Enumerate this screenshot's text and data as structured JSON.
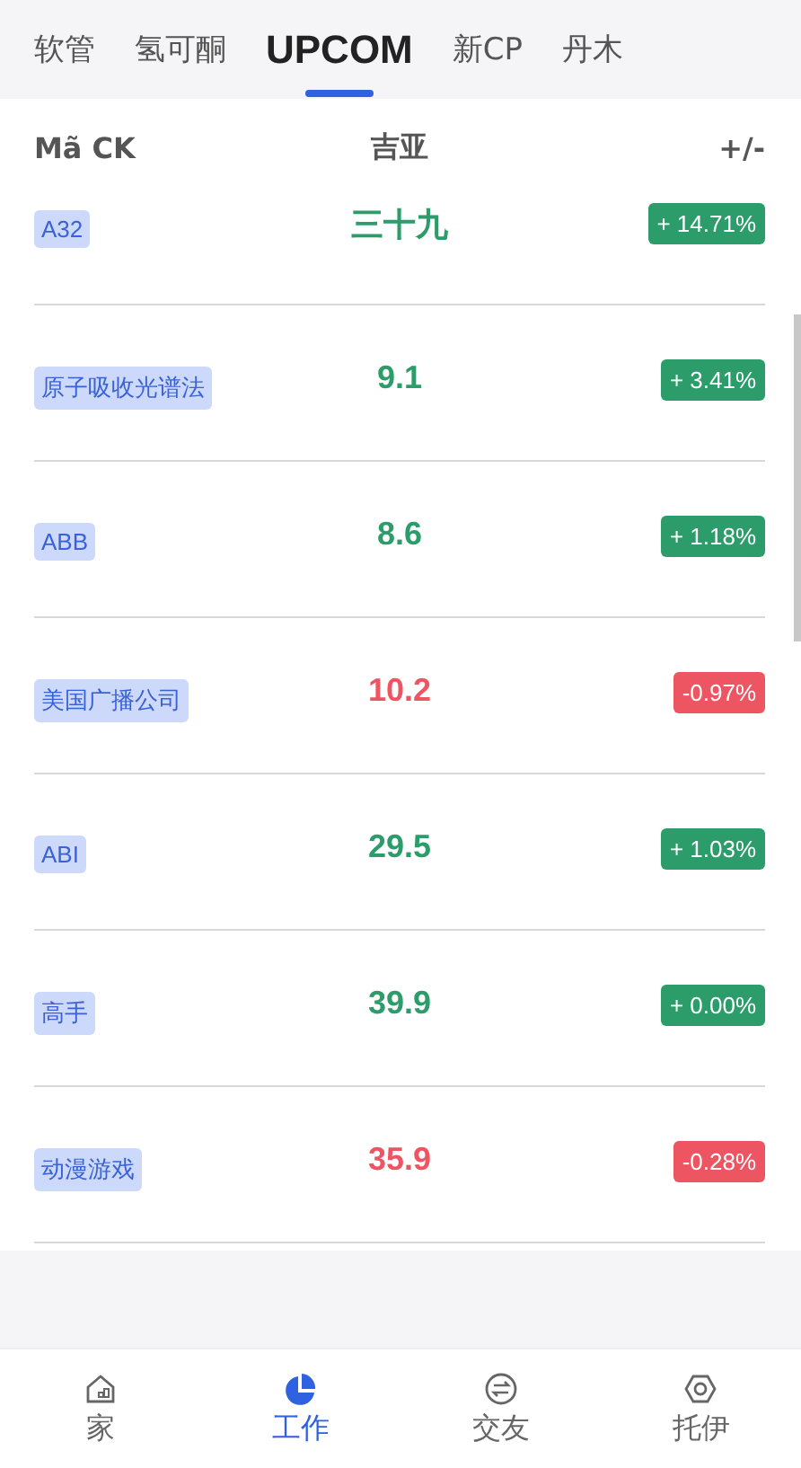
{
  "tabs": [
    {
      "label": "软管",
      "selected": false
    },
    {
      "label": "氢可酮",
      "selected": false
    },
    {
      "label": "UPCOM",
      "selected": true
    },
    {
      "label": "新CP",
      "selected": false
    },
    {
      "label": "丹木",
      "selected": false
    }
  ],
  "table": {
    "columns": [
      "Mã CK",
      "吉亚",
      "+/-"
    ],
    "rows": [
      {
        "code": "A32",
        "price": "三十九",
        "change": "+ 14.71%",
        "color": "#2c9c6a"
      },
      {
        "code": "原子吸收光谱法",
        "price": "9.1",
        "change": "+ 3.41%",
        "color": "#2c9c6a"
      },
      {
        "code": "ABB",
        "price": "8.6",
        "change": "+ 1.18%",
        "color": "#2c9c6a"
      },
      {
        "code": "美国广播公司",
        "price": "10.2",
        "change": "-0.97%",
        "color": "#ee5563"
      },
      {
        "code": "ABI",
        "price": "29.5",
        "change": "+ 1.03%",
        "color": "#2c9c6a"
      },
      {
        "code": "高手",
        "price": "39.9",
        "change": "+ 0.00%",
        "color": "#2c9c6a"
      },
      {
        "code": "动漫游戏",
        "price": "35.9",
        "change": "-0.28%",
        "color": "#ee5563"
      }
    ]
  },
  "bottom_nav": [
    {
      "label": "家",
      "selected": false
    },
    {
      "label": "工作",
      "selected": true
    },
    {
      "label": "交友",
      "selected": false
    },
    {
      "label": "托伊",
      "selected": false
    }
  ]
}
